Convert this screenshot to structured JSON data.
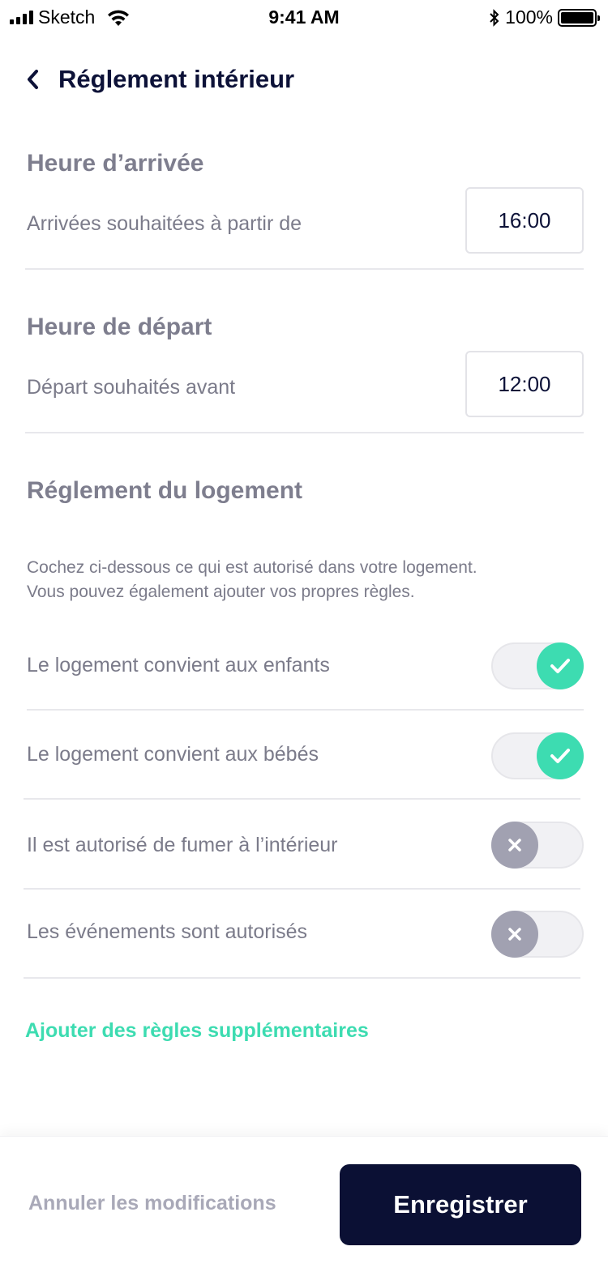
{
  "status_bar": {
    "carrier": "Sketch",
    "time": "9:41 AM",
    "battery": "100%"
  },
  "header": {
    "title": "Réglement intérieur"
  },
  "arrival": {
    "title": "Heure d’arrivée",
    "label": "Arrivées souhaitées à partir de",
    "time": "16:00"
  },
  "departure": {
    "title": "Heure de départ",
    "label": "Départ souhaités avant",
    "time": "12:00"
  },
  "rules": {
    "title": "Réglement du logement",
    "description_line1": "Cochez ci-dessous ce qui est autorisé dans votre logement.",
    "description_line2": "Vous pouvez également ajouter vos propres règles.",
    "items": [
      {
        "label": "Le logement convient aux enfants",
        "enabled": true
      },
      {
        "label": "Le logement convient aux bébés",
        "enabled": true
      },
      {
        "label": "Il est autorisé de fumer à l’intérieur",
        "enabled": false
      },
      {
        "label": "Les événements sont autorisés",
        "enabled": false
      }
    ],
    "add_link": "Ajouter des règles supplémentaires"
  },
  "footer": {
    "cancel_label": "Annuler les modifications",
    "save_label": "Enregistrer"
  },
  "colors": {
    "accent": "#3ddcb1",
    "primary_dark": "#0b1034",
    "toggle_off_knob": "#a1a1b1"
  }
}
